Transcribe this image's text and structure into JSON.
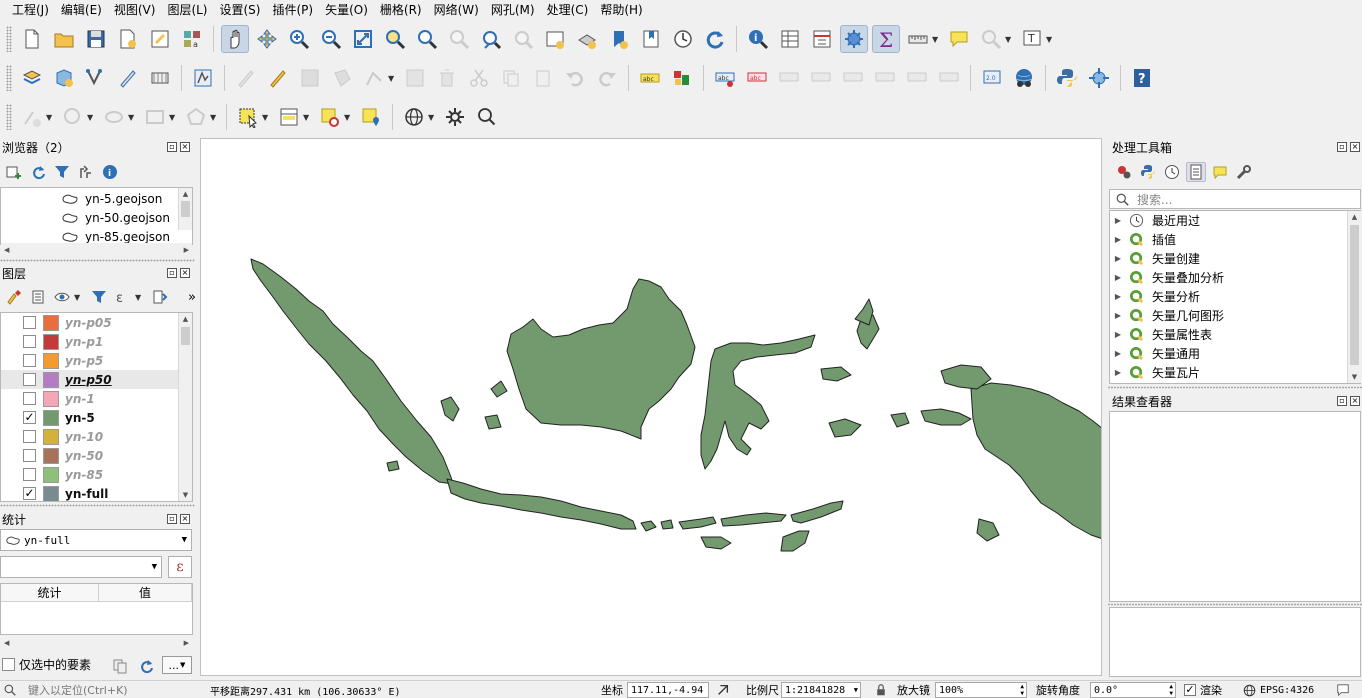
{
  "menu": [
    "工程(J)",
    "编辑(E)",
    "视图(V)",
    "图层(L)",
    "设置(S)",
    "插件(P)",
    "矢量(O)",
    "栅格(R)",
    "网络(W)",
    "网孔(M)",
    "处理(C)",
    "帮助(H)"
  ],
  "browser": {
    "title": "浏览器（2）",
    "files": [
      "yn-5.geojson",
      "yn-50.geojson",
      "yn-85.geojson"
    ]
  },
  "layers": {
    "title": "图层",
    "more": "»",
    "items": [
      {
        "name": "yn-p05",
        "color": "#e86f3d",
        "checked": false
      },
      {
        "name": "yn-p1",
        "color": "#c23b3b",
        "checked": false
      },
      {
        "name": "yn-p5",
        "color": "#f59a2e",
        "checked": false
      },
      {
        "name": "yn-p50",
        "color": "#b57bc4",
        "checked": false
      },
      {
        "name": "yn-1",
        "color": "#f4a7b9",
        "checked": false
      },
      {
        "name": "yn-5",
        "color": "#739a6e",
        "checked": true
      },
      {
        "name": "yn-10",
        "color": "#d4b13b",
        "checked": false
      },
      {
        "name": "yn-50",
        "color": "#a8735a",
        "checked": false
      },
      {
        "name": "yn-85",
        "color": "#8fc07a",
        "checked": false
      },
      {
        "name": "yn-full",
        "color": "#7a8a91",
        "checked": true
      }
    ]
  },
  "stats": {
    "title": "统计",
    "layer_combo": "yn-full",
    "col_stat": "统计",
    "col_value": "值",
    "selected_only": "仅选中的要素",
    "more": "..."
  },
  "toolbox": {
    "title": "处理工具箱",
    "search_placeholder": "搜索...",
    "items": [
      "最近用过",
      "插值",
      "矢量创建",
      "矢量叠加分析",
      "矢量分析",
      "矢量几何图形",
      "矢量属性表",
      "矢量通用",
      "矢量瓦片"
    ]
  },
  "results": {
    "title": "结果查看器"
  },
  "status": {
    "locator_placeholder": "键入以定位(Ctrl+K)",
    "message": "平移距离297.431 km (106.30633° E)",
    "coord_label": "坐标",
    "coord_value": "117.11,-4.94",
    "scale_label": "比例尺",
    "scale_value": "1:21841828",
    "magnifier_label": "放大镜",
    "magnifier_value": "100%",
    "rotation_label": "旋转角度",
    "rotation_value": "0.0°",
    "render_label": "渲染",
    "crs": "EPSG:4326"
  },
  "colors": {
    "land": "#739a6e",
    "outline": "#222222",
    "accent": "#2f6fb5"
  }
}
